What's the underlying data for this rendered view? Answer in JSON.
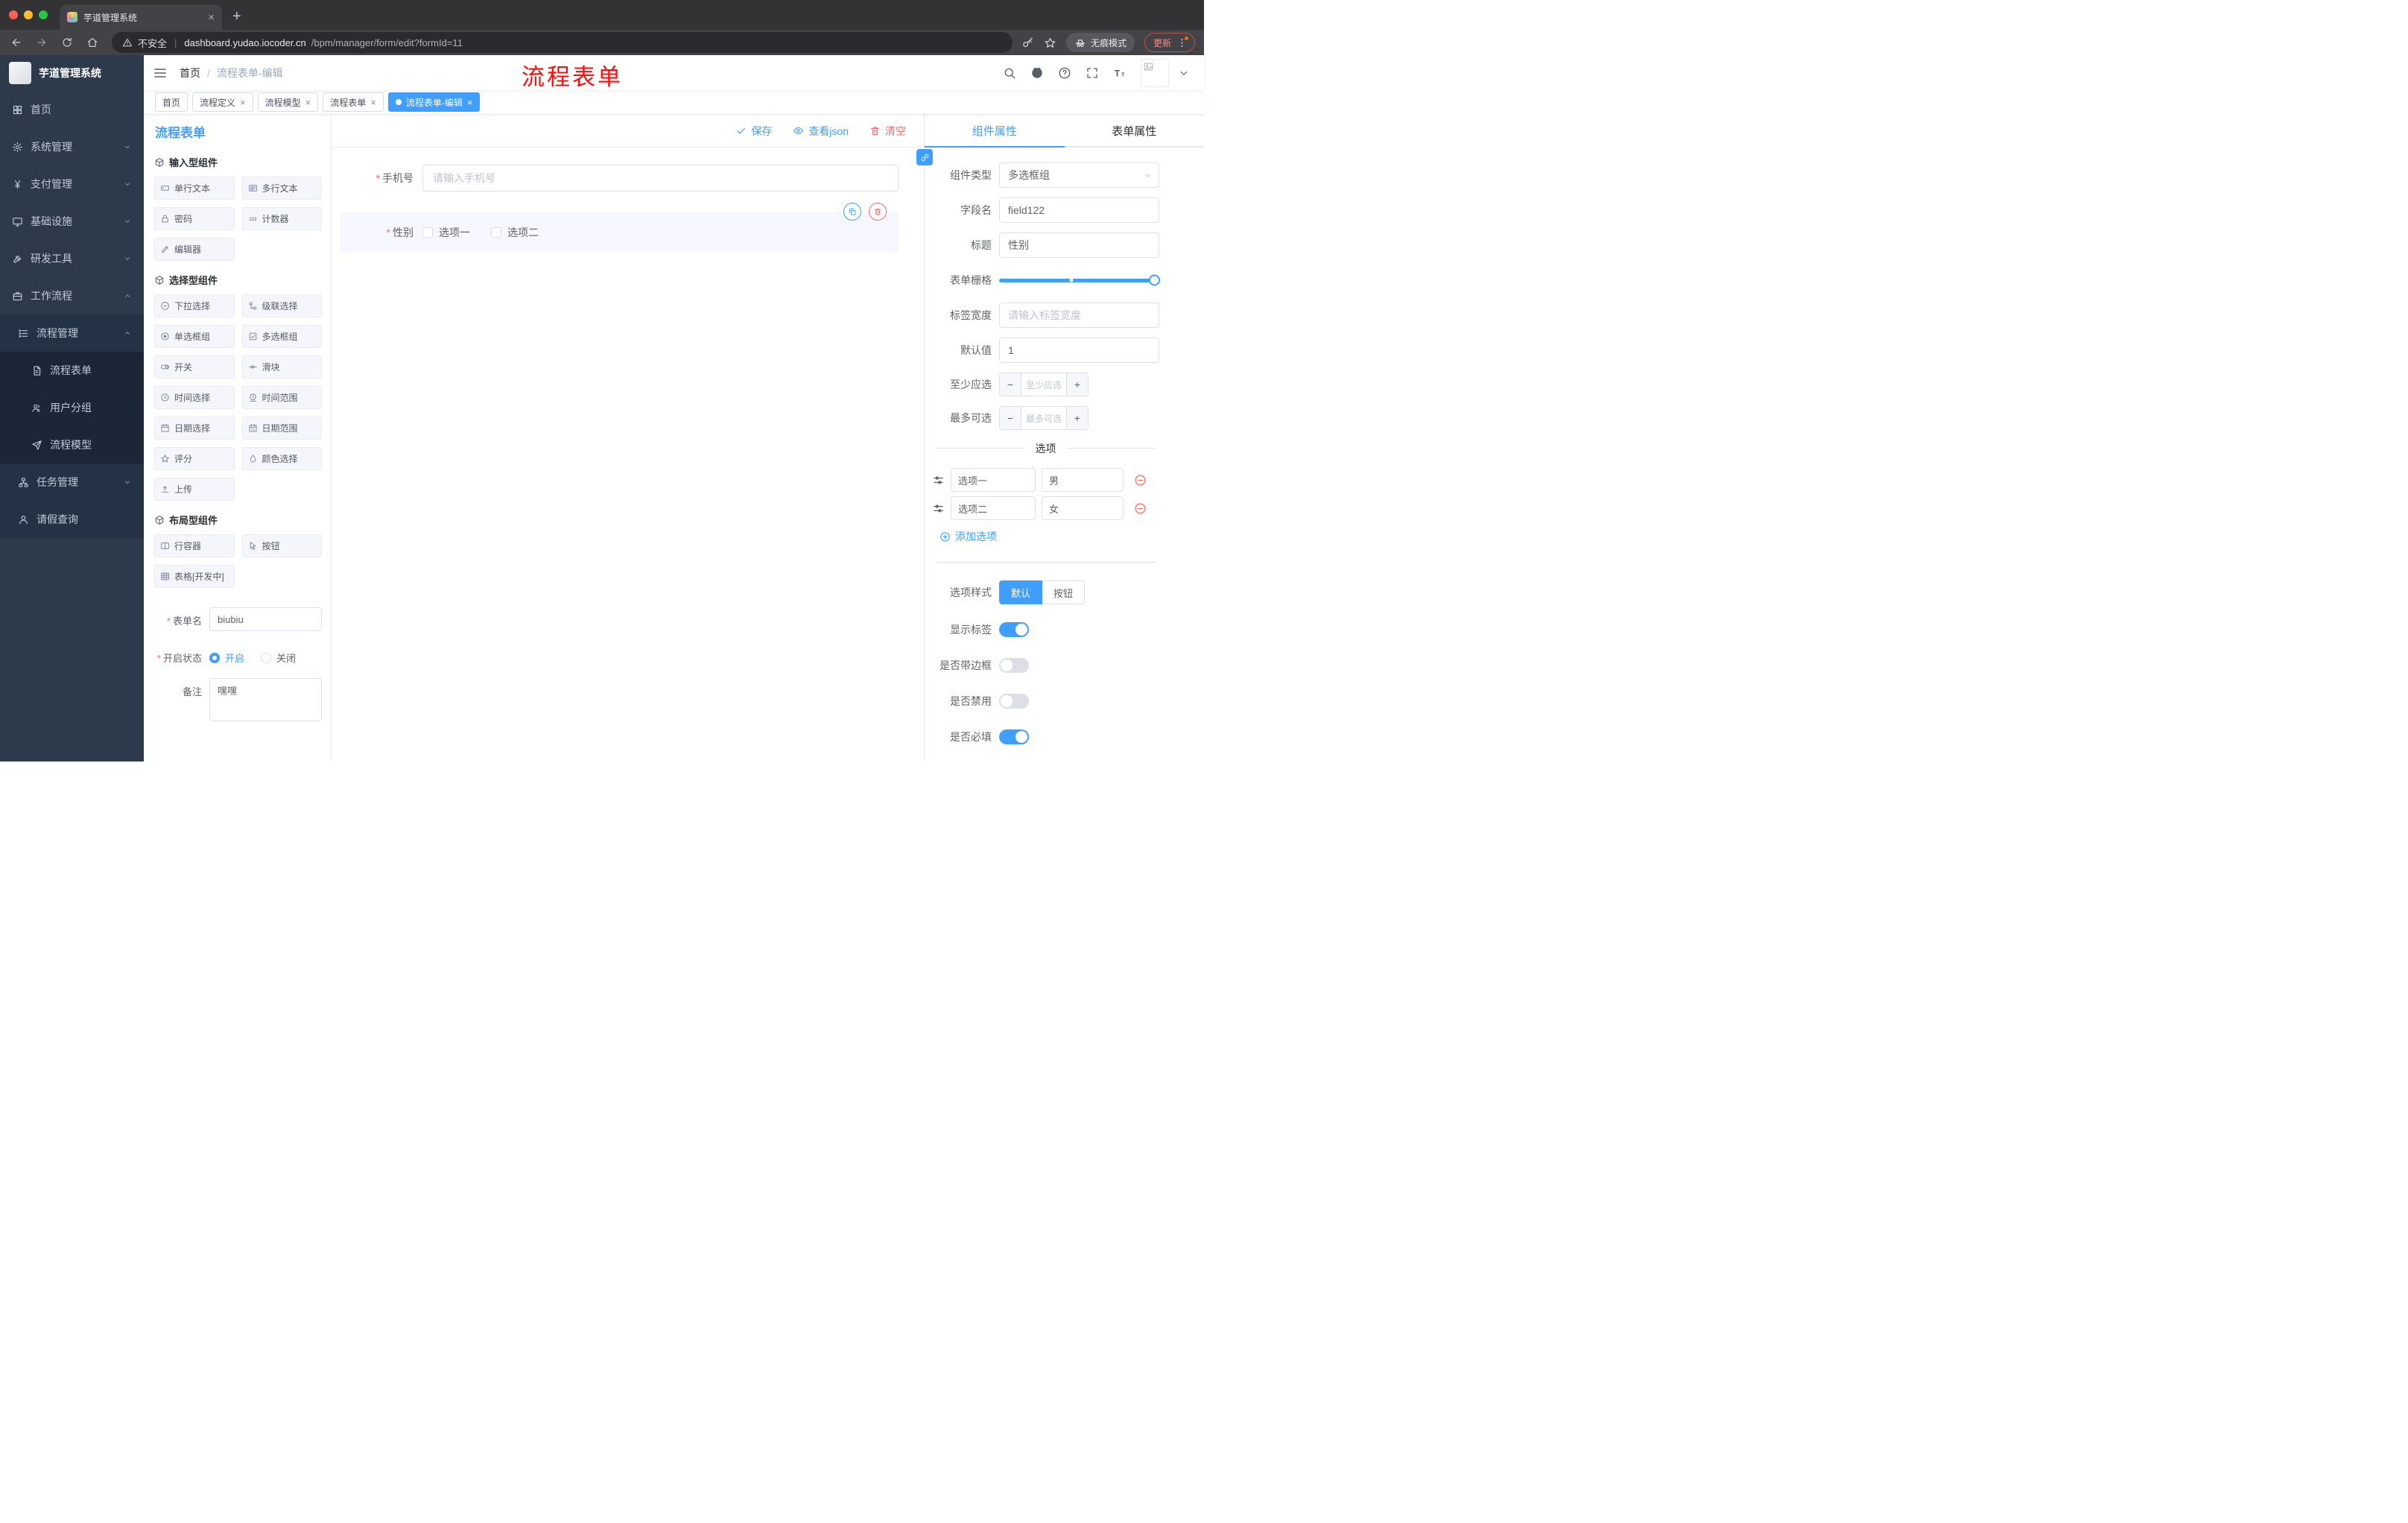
{
  "browser": {
    "tab": {
      "title": "芋道管理系统"
    },
    "security_label": "不安全",
    "url_domain": "dashboard.yudao.iocoder.cn",
    "url_path": "/bpm/manager/form/edit?formId=11",
    "incognito_label": "无痕模式",
    "update_label": "更新"
  },
  "ui": {
    "close_glyph": "×",
    "new_tab_glyph": "+",
    "required_mark": "*",
    "breadcrumb_separator": "/",
    "url_separator": "|",
    "minus_glyph": "−",
    "plus_glyph": "+"
  },
  "annotation": {
    "text": "流程表单",
    "color": "#fb0d0d"
  },
  "app_header": {
    "breadcrumb": {
      "root": "首页",
      "current": "流程表单-编辑"
    }
  },
  "tags": [
    {
      "label": "首页",
      "closable": false,
      "active": false
    },
    {
      "label": "流程定义",
      "closable": true,
      "active": false
    },
    {
      "label": "流程模型",
      "closable": true,
      "active": false
    },
    {
      "label": "流程表单",
      "closable": true,
      "active": false
    },
    {
      "label": "流程表单-编辑",
      "closable": true,
      "active": true
    }
  ],
  "sidebar": {
    "logo_title": "芋道管理系统",
    "items": [
      {
        "label": "首页",
        "icon": "dashboard-icon",
        "level": 1
      },
      {
        "label": "系统管理",
        "icon": "gear-icon",
        "level": 1,
        "expand": "down"
      },
      {
        "label": "支付管理",
        "icon": "yen-icon",
        "level": 1,
        "expand": "down"
      },
      {
        "label": "基础设施",
        "icon": "monitor-icon",
        "level": 1,
        "expand": "down"
      },
      {
        "label": "研发工具",
        "icon": "tools-icon",
        "level": 1,
        "expand": "down"
      },
      {
        "label": "工作流程",
        "icon": "briefcase-icon",
        "level": 1,
        "expand": "up"
      },
      {
        "label": "流程管理",
        "icon": "list-icon",
        "level": 2,
        "expand": "up"
      },
      {
        "label": "流程表单",
        "icon": "document-icon",
        "level": 3
      },
      {
        "label": "用户分组",
        "icon": "users-icon",
        "level": 3
      },
      {
        "label": "流程模型",
        "icon": "send-icon",
        "level": 3
      },
      {
        "label": "任务管理",
        "icon": "sitemap-icon",
        "level": 2,
        "expand": "down"
      },
      {
        "label": "请假查询",
        "icon": "user-icon",
        "level": 2
      }
    ]
  },
  "designer": {
    "title": "流程表单",
    "actions": {
      "save": "保存",
      "view_json": "查看json",
      "clear": "清空"
    }
  },
  "components": {
    "sections": [
      {
        "title": "输入型组件",
        "items": [
          {
            "label": "单行文本",
            "icon": "single-line-text-icon"
          },
          {
            "label": "多行文本",
            "icon": "multi-line-text-icon"
          },
          {
            "label": "密码",
            "icon": "password-lock-icon"
          },
          {
            "label": "计数器",
            "icon": "counter-icon"
          },
          {
            "label": "编辑器",
            "icon": "editor-pencil-icon"
          }
        ]
      },
      {
        "title": "选择型组件",
        "items": [
          {
            "label": "下拉选择",
            "icon": "select-dropdown-icon"
          },
          {
            "label": "级联选择",
            "icon": "cascader-icon"
          },
          {
            "label": "单选框组",
            "icon": "radio-group-icon"
          },
          {
            "label": "多选框组",
            "icon": "checkbox-group-icon"
          },
          {
            "label": "开关",
            "icon": "switch-icon"
          },
          {
            "label": "滑块",
            "icon": "slider-icon"
          },
          {
            "label": "时间选择",
            "icon": "time-picker-icon"
          },
          {
            "label": "时间范围",
            "icon": "time-range-icon"
          },
          {
            "label": "日期选择",
            "icon": "date-picker-icon"
          },
          {
            "label": "日期范围",
            "icon": "date-range-icon"
          },
          {
            "label": "评分",
            "icon": "rate-star-icon"
          },
          {
            "label": "颜色选择",
            "icon": "color-picker-icon"
          },
          {
            "label": "上传",
            "icon": "upload-icon"
          }
        ]
      },
      {
        "title": "布局型组件",
        "items": [
          {
            "label": "行容器",
            "icon": "row-container-icon"
          },
          {
            "label": "按钮",
            "icon": "button-pointer-icon"
          },
          {
            "label": "表格[开发中]",
            "icon": "table-icon"
          }
        ]
      }
    ]
  },
  "meta_form": {
    "form_name": {
      "label": "表单名",
      "value": "biubiu",
      "required": true
    },
    "status": {
      "label": "开启状态",
      "required": true,
      "options": [
        "开启",
        "关闭"
      ],
      "selected": "开启"
    },
    "remark": {
      "label": "备注",
      "value": "嘿嘿"
    }
  },
  "canvas": {
    "phone": {
      "label": "手机号",
      "placeholder": "请输入手机号",
      "required": true
    },
    "gender": {
      "label": "性别",
      "required": true,
      "options": [
        {
          "label": "选项一",
          "checked": false
        },
        {
          "label": "选项二",
          "checked": false
        }
      ]
    }
  },
  "panel": {
    "tabs": [
      {
        "label": "组件属性",
        "active": true
      },
      {
        "label": "表单属性",
        "active": false
      }
    ],
    "component_type": {
      "label": "组件类型",
      "value": "多选框组"
    },
    "field_name": {
      "label": "字段名",
      "value": "field122"
    },
    "title": {
      "label": "标题",
      "value": "性别"
    },
    "grid": {
      "label": "表单栅格",
      "handle_position": "end",
      "mark_position": "middle"
    },
    "label_width": {
      "label": "标签宽度",
      "placeholder": "请输入标签宽度"
    },
    "default_value": {
      "label": "默认值",
      "value": "1"
    },
    "min_select": {
      "label": "至少应选",
      "placeholder": "至少应选"
    },
    "max_select": {
      "label": "最多可选",
      "placeholder": "最多可选"
    },
    "options_divider": "选项",
    "options": [
      {
        "name": "选项一",
        "value": "男"
      },
      {
        "name": "选项二",
        "value": "女"
      }
    ],
    "add_option": "添加选项",
    "option_style": {
      "label": "选项样式",
      "choices": [
        {
          "label": "默认",
          "active": true
        },
        {
          "label": "按钮",
          "active": false
        }
      ]
    },
    "switches": [
      {
        "label": "显示标签",
        "on": true
      },
      {
        "label": "是否带边框",
        "on": false
      },
      {
        "label": "是否禁用",
        "on": false
      },
      {
        "label": "是否必填",
        "on": true
      }
    ]
  },
  "colors": {
    "accent": "#409eff",
    "danger": "#f56c6c",
    "annotation_red": "#fb0d0d",
    "sidebar_bg": "#2d3a4b",
    "selected_block_bg": "#f6f7ff"
  }
}
